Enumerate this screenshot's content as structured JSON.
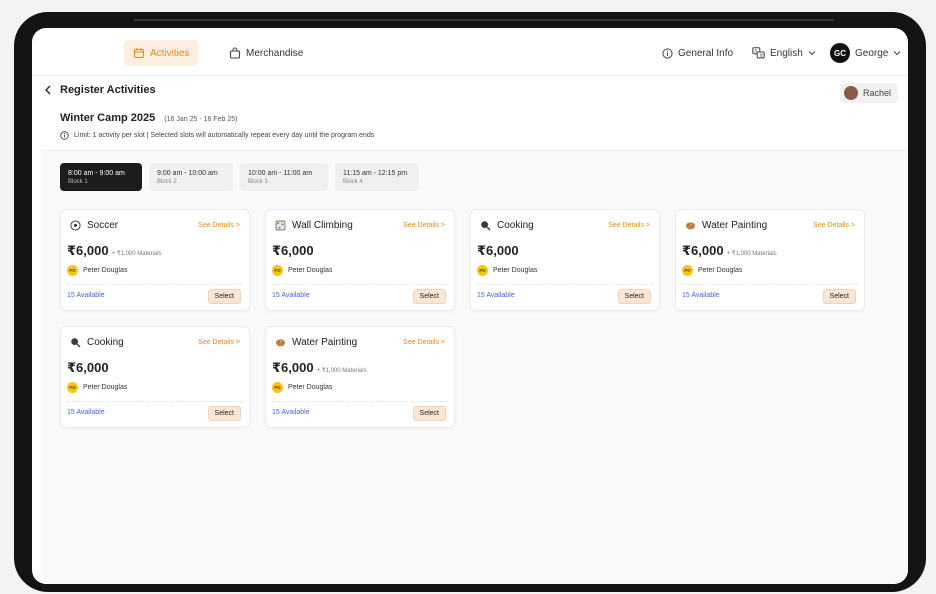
{
  "nav": {
    "tabs": [
      {
        "label": "Activities",
        "icon": "calendar-icon"
      },
      {
        "label": "Merchandise",
        "icon": "bag-icon"
      }
    ],
    "general_info": "General Info",
    "language": "English",
    "user_initials": "GC",
    "user_name": "George"
  },
  "header": {
    "back_title": "Register Activities",
    "child_name": "Rachel",
    "camp_name": "Winter Camp 2025",
    "camp_dates": "(16 Jan 25 - 16 Feb 25)",
    "limit_text": "Limit: 1 activity per slot |  Selected slots will automatically repeat every day until the program ends"
  },
  "slots": [
    {
      "time": "8:00 am - 9:00 am",
      "block": "Block 1",
      "active": true
    },
    {
      "time": "9:00 am - 10:00 am",
      "block": "Block 2",
      "active": false
    },
    {
      "time": "10:00 am - 11:00 am",
      "block": "Block 3",
      "active": false
    },
    {
      "time": "11:15 am - 12:15 pm",
      "block": "Block 4",
      "active": false
    }
  ],
  "cards": [
    {
      "name": "Soccer",
      "icon": "soccer-ball-icon",
      "details": "See Details >",
      "price": "₹6,000",
      "materials": "+ ₹1,000 Materials",
      "coach_initials": "PD",
      "coach": "Peter Douglas",
      "available": "15 Available",
      "select": "Select"
    },
    {
      "name": "Wall Climbing",
      "icon": "climbing-icon",
      "details": "See Details >",
      "price": "₹6,000",
      "materials": "",
      "coach_initials": "PD",
      "coach": "Peter Douglas",
      "available": "15 Available",
      "select": "Select"
    },
    {
      "name": "Cooking",
      "icon": "cooking-icon",
      "details": "See Details >",
      "price": "₹6,000",
      "materials": "",
      "coach_initials": "PD",
      "coach": "Peter Douglas",
      "available": "15 Available",
      "select": "Select"
    },
    {
      "name": "Water Painting",
      "icon": "palette-icon",
      "details": "See Details >",
      "price": "₹6,000",
      "materials": "+ ₹1,000 Materials",
      "coach_initials": "PD",
      "coach": "Peter Douglas",
      "available": "15 Available",
      "select": "Select"
    },
    {
      "name": "Cooking",
      "icon": "cooking-icon",
      "details": "See Details >",
      "price": "₹6,000",
      "materials": "",
      "coach_initials": "PD",
      "coach": "Peter Douglas",
      "available": "15 Available",
      "select": "Select"
    },
    {
      "name": "Water Painting",
      "icon": "palette-icon",
      "details": "See Details >",
      "price": "₹6,000",
      "materials": "+ ₹1,000 Materials",
      "coach_initials": "PD",
      "coach": "Peter Douglas",
      "available": "15 Available",
      "select": "Select"
    }
  ],
  "colors": {
    "accent": "#e08a1e",
    "accent_bg": "#fcefdf",
    "available": "#4a63d9",
    "select_bg": "#fbe5d3",
    "active_slot": "#1c1c1c"
  }
}
